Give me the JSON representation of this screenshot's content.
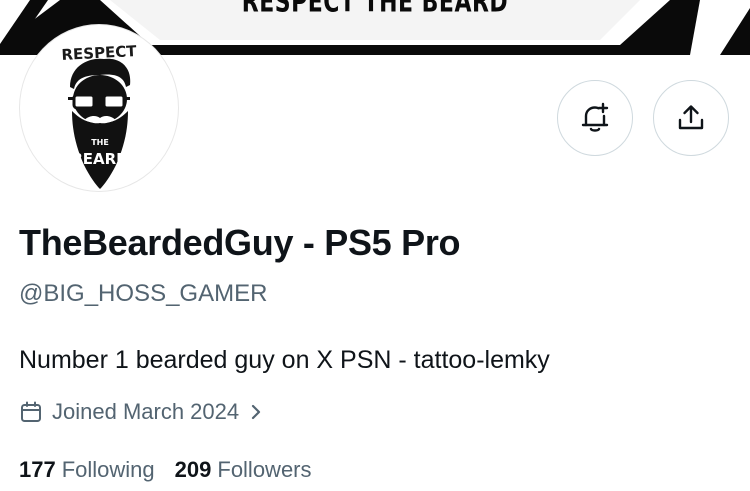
{
  "banner": {
    "text": "RESPECT THE BEARD"
  },
  "avatar": {
    "top_text": "RESPECT",
    "middle_text": "THE",
    "bottom_text": "BEARD"
  },
  "actions": {
    "notify_icon": "bell-plus-icon",
    "share_icon": "share-upload-icon"
  },
  "profile": {
    "display_name": "TheBeardedGuy - PS5 Pro",
    "handle": "@BIG_HOSS_GAMER",
    "bio": "Number 1 bearded guy on X PSN - tattoo-lemky",
    "joined": "Joined March 2024"
  },
  "stats": {
    "following_count": "177",
    "following_label": "Following",
    "followers_count": "209",
    "followers_label": "Followers"
  }
}
